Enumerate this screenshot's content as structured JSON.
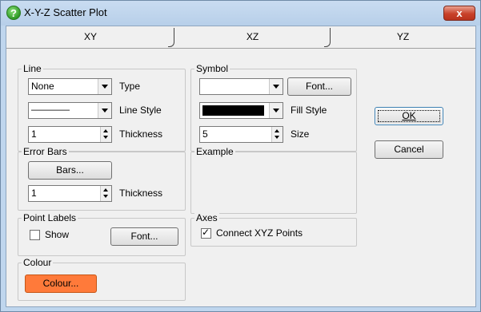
{
  "window": {
    "title": "X-Y-Z Scatter Plot",
    "close_label": "x"
  },
  "tabs": [
    {
      "label": "XY"
    },
    {
      "label": "XZ"
    },
    {
      "label": "YZ"
    }
  ],
  "line_group": {
    "title": "Line",
    "type_value": "None",
    "type_label": "Type",
    "style_value": "————",
    "style_label": "Line Style",
    "thickness_value": "1",
    "thickness_label": "Thickness"
  },
  "error_bars_group": {
    "title": "Error Bars",
    "bars_button": "Bars...",
    "thickness_value": "1",
    "thickness_label": "Thickness"
  },
  "point_labels_group": {
    "title": "Point Labels",
    "show_label": "Show",
    "show_checked": false,
    "font_button": "Font..."
  },
  "colour_group": {
    "title": "Colour",
    "colour_button": "Colour...",
    "colour_hex": "#ff7a3a"
  },
  "symbol_group": {
    "title": "Symbol",
    "symbol_value": "",
    "font_button": "Font...",
    "fill_value_color": "#000000",
    "fill_label": "Fill Style",
    "size_value": "5",
    "size_label": "Size"
  },
  "example_group": {
    "title": "Example"
  },
  "axes_group": {
    "title": "Axes",
    "connect_label": "Connect XYZ Points",
    "connect_checked": true
  },
  "dialog_buttons": {
    "ok": "OK",
    "cancel": "Cancel"
  }
}
